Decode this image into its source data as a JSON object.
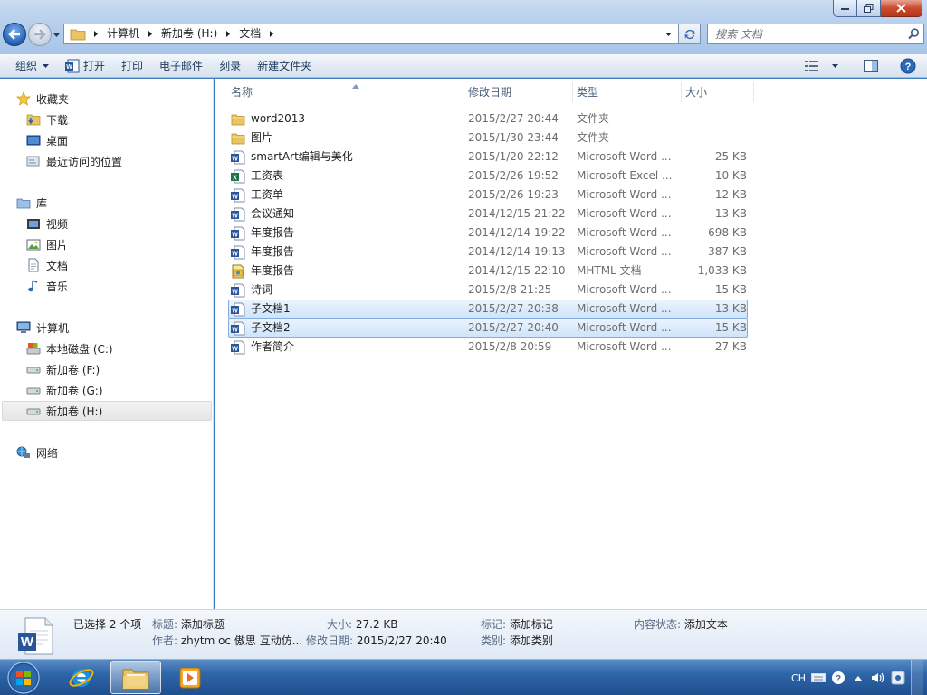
{
  "address": {
    "crumbs": [
      "计算机",
      "新加卷 (H:)",
      "文档"
    ]
  },
  "search": {
    "placeholder": "搜索 文档"
  },
  "toolbar": {
    "organize": "组织",
    "open": "打开",
    "print": "打印",
    "email": "电子邮件",
    "burn": "刻录",
    "new_folder": "新建文件夹"
  },
  "nav": {
    "favorites": "收藏夹",
    "downloads": "下载",
    "desktop": "桌面",
    "recent": "最近访问的位置",
    "libraries": "库",
    "videos": "视频",
    "pictures": "图片",
    "documents": "文档",
    "music": "音乐",
    "computer": "计算机",
    "drive_c": "本地磁盘 (C:)",
    "drive_f": "新加卷 (F:)",
    "drive_g": "新加卷 (G:)",
    "drive_h": "新加卷 (H:)",
    "network": "网络"
  },
  "columns": {
    "name": "名称",
    "date": "修改日期",
    "type": "类型",
    "size": "大小"
  },
  "files": [
    {
      "name": "word2013",
      "date": "2015/2/27 20:44",
      "type": "文件夹",
      "size": "",
      "icon": "folder",
      "selected": false
    },
    {
      "name": "图片",
      "date": "2015/1/30 23:44",
      "type": "文件夹",
      "size": "",
      "icon": "folder",
      "selected": false
    },
    {
      "name": "smartArt编辑与美化",
      "date": "2015/1/20 22:12",
      "type": "Microsoft Word ...",
      "size": "25 KB",
      "icon": "word",
      "selected": false
    },
    {
      "name": "工资表",
      "date": "2015/2/26 19:52",
      "type": "Microsoft Excel ...",
      "size": "10 KB",
      "icon": "excel",
      "selected": false
    },
    {
      "name": "工资单",
      "date": "2015/2/26 19:23",
      "type": "Microsoft Word ...",
      "size": "12 KB",
      "icon": "word",
      "selected": false
    },
    {
      "name": "会议通知",
      "date": "2014/12/15 21:22",
      "type": "Microsoft Word ...",
      "size": "13 KB",
      "icon": "word",
      "selected": false
    },
    {
      "name": "年度报告",
      "date": "2014/12/14 19:22",
      "type": "Microsoft Word ...",
      "size": "698 KB",
      "icon": "word",
      "selected": false
    },
    {
      "name": "年度报告",
      "date": "2014/12/14 19:13",
      "type": "Microsoft Word ...",
      "size": "387 KB",
      "icon": "word",
      "selected": false
    },
    {
      "name": "年度报告",
      "date": "2014/12/15 22:10",
      "type": "MHTML 文档",
      "size": "1,033 KB",
      "icon": "mhtml",
      "selected": false
    },
    {
      "name": "诗词",
      "date": "2015/2/8 21:25",
      "type": "Microsoft Word ...",
      "size": "15 KB",
      "icon": "word",
      "selected": false
    },
    {
      "name": "子文档1",
      "date": "2015/2/27 20:38",
      "type": "Microsoft Word ...",
      "size": "13 KB",
      "icon": "word",
      "selected": true
    },
    {
      "name": "子文档2",
      "date": "2015/2/27 20:40",
      "type": "Microsoft Word ...",
      "size": "15 KB",
      "icon": "word",
      "selected": true
    },
    {
      "name": "作者简介",
      "date": "2015/2/8 20:59",
      "type": "Microsoft Word ...",
      "size": "27 KB",
      "icon": "word",
      "selected": false
    }
  ],
  "details": {
    "selected_count": "已选择 2 个项",
    "title_key": "标题:",
    "title_val": "添加标题",
    "author_key": "作者:",
    "author_val": "zhytm oc 傲思",
    "author_more": "互动仿...",
    "size_key": "大小:",
    "size_val": "27.2 KB",
    "modified_key": "修改日期:",
    "modified_val": "2015/2/27 20:40",
    "tags_key": "标记:",
    "tags_val": "添加标记",
    "category_key": "类别:",
    "category_val": "添加类别",
    "status_key": "内容状态:",
    "status_val": "添加文本"
  },
  "tray": {
    "lang": "CH"
  },
  "colors": {
    "selection": "#cfe4fb",
    "selection_border": "#84acdd",
    "taskbar": "#2e66aa"
  }
}
